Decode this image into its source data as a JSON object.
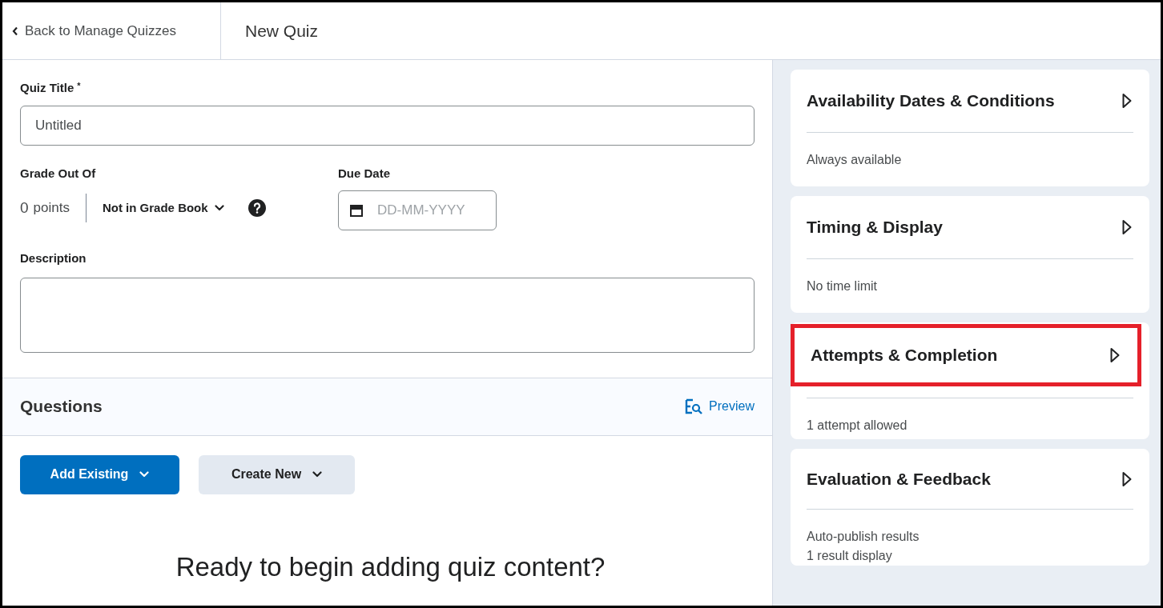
{
  "header": {
    "back_link": "Back to Manage Quizzes",
    "title": "New Quiz"
  },
  "form": {
    "title_label": "Quiz Title",
    "required_mark": "*",
    "title_value": "Untitled",
    "grade_label": "Grade Out Of",
    "points": "0",
    "points_unit": "points",
    "grade_book": "Not in Grade Book",
    "due_label": "Due Date",
    "due_placeholder": "DD-MM-YYYY",
    "description_label": "Description"
  },
  "questions": {
    "heading": "Questions",
    "preview": "Preview",
    "buttons": [
      {
        "label": "Add Existing",
        "kind": "primary"
      },
      {
        "label": "Create New",
        "kind": "secondary"
      }
    ],
    "empty_message": "Ready to begin adding quiz content?"
  },
  "sidebar": {
    "sections": [
      {
        "title": "Availability Dates & Conditions",
        "summary": [
          "Always available"
        ],
        "highlighted": false
      },
      {
        "title": "Timing & Display",
        "summary": [
          "No time limit"
        ],
        "highlighted": false
      },
      {
        "title": "Attempts & Completion",
        "summary": [
          "1 attempt allowed"
        ],
        "highlighted": true
      },
      {
        "title": "Evaluation & Feedback",
        "summary": [
          "Auto-publish results",
          "1 result display"
        ],
        "highlighted": false
      }
    ]
  }
}
